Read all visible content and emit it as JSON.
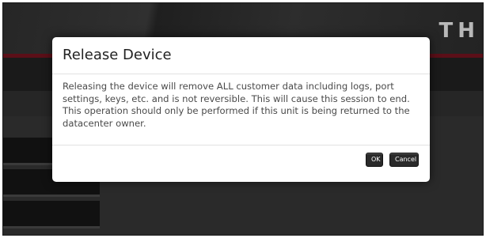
{
  "background": {
    "logo_text": "TH"
  },
  "dialog": {
    "title": "Release Device",
    "message": "Releasing the device will remove ALL customer data including logs, port settings, keys, etc. and is not reversible. This will cause this session to end. This operation should only be performed if this unit is being returned to the datacenter owner.",
    "ok_label": "OK",
    "cancel_label": "Cancel"
  }
}
